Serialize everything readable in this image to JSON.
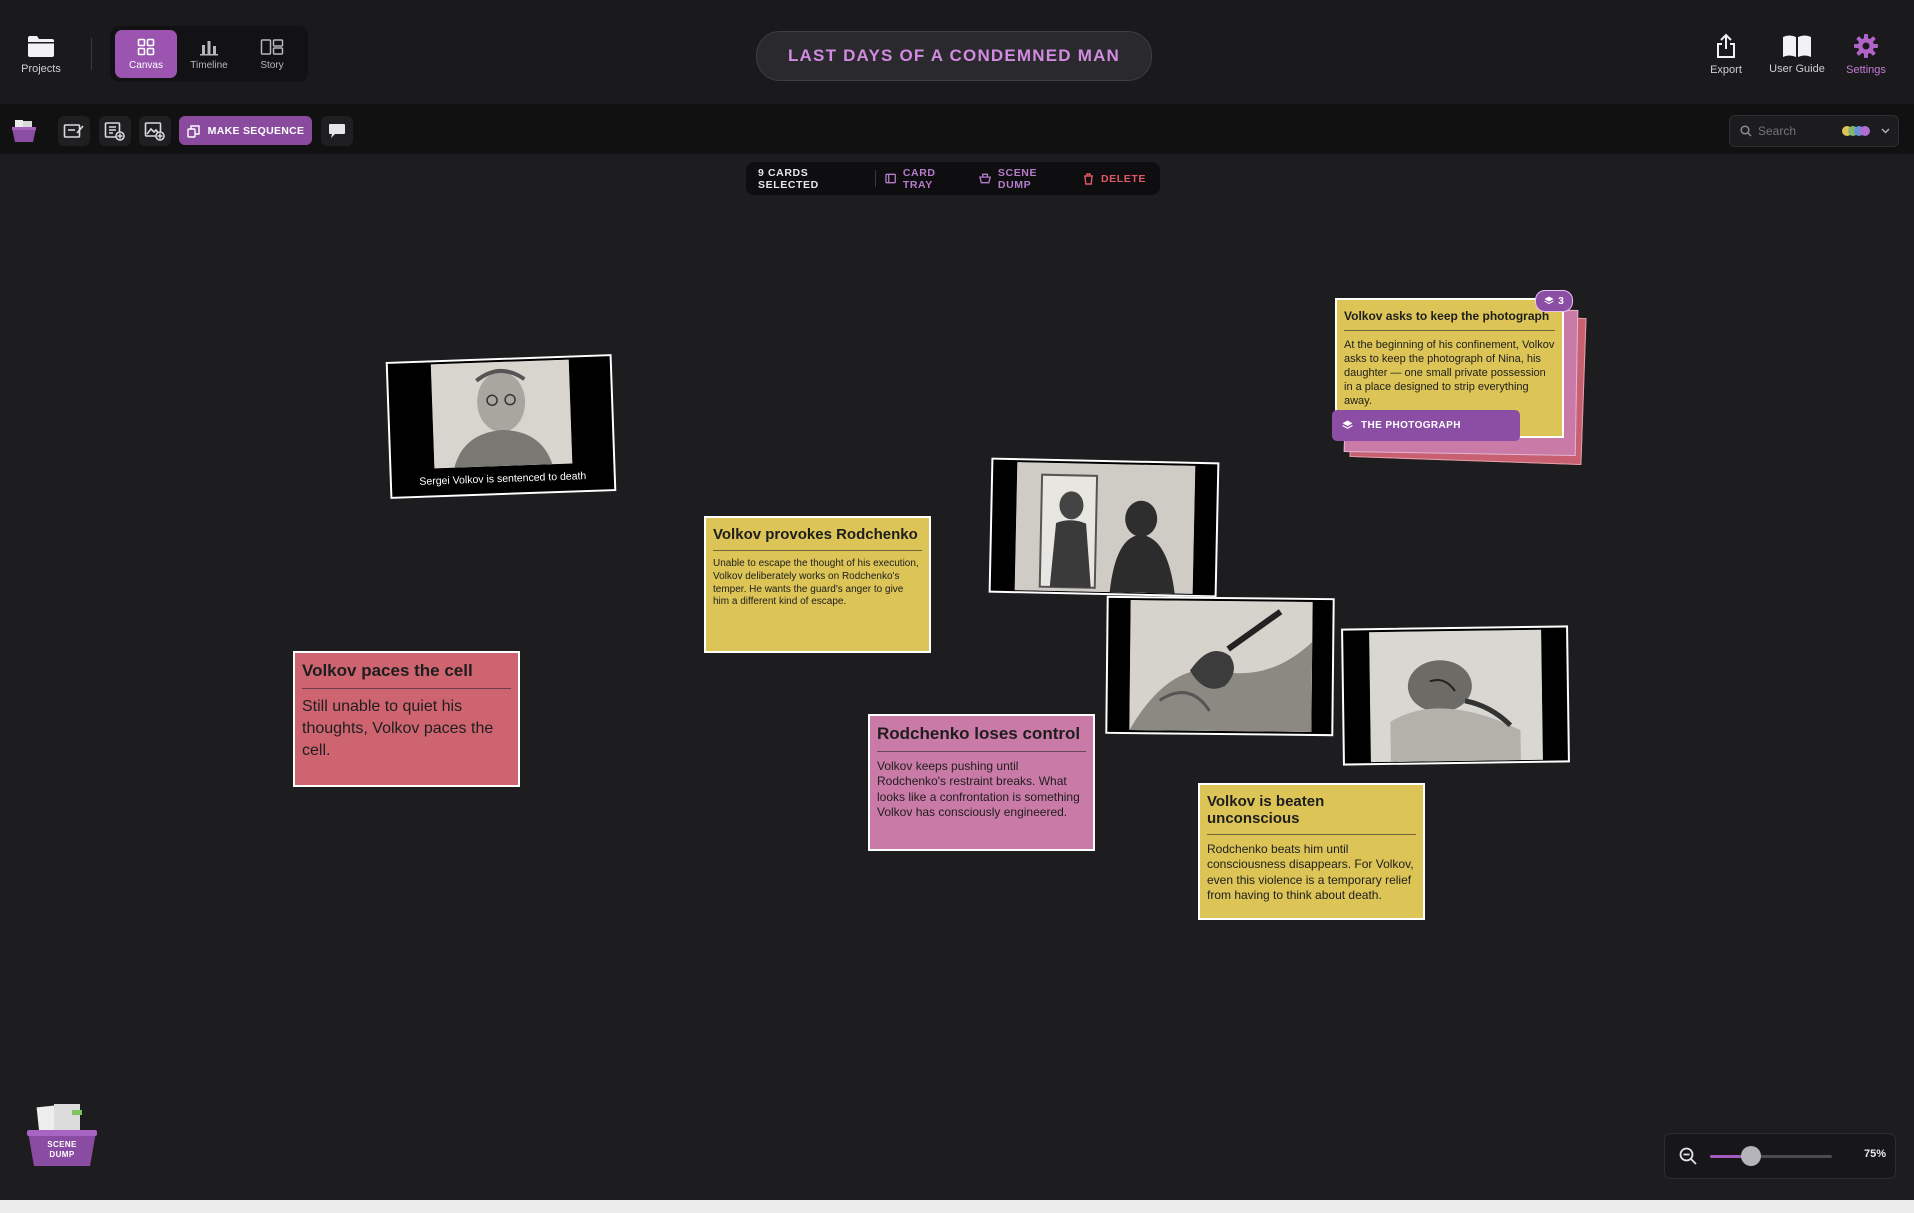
{
  "header": {
    "projects_label": "Projects",
    "modes": [
      {
        "label": "Canvas",
        "icon": "grid-icon"
      },
      {
        "label": "Timeline",
        "icon": "bar-chart-icon"
      },
      {
        "label": "Story",
        "icon": "story-icon"
      }
    ],
    "active_mode": "Canvas",
    "title": "LAST DAYS OF A CONDEMNED MAN",
    "right_actions": [
      {
        "label": "Export",
        "icon": "share-icon"
      },
      {
        "label": "User Guide",
        "icon": "book-icon"
      },
      {
        "label": "Settings",
        "icon": "gear-icon"
      }
    ]
  },
  "toolbar": {
    "make_sequence_label": "MAKE SEQUENCE",
    "search_placeholder": "Search"
  },
  "selection_bar": {
    "count_label": "9 CARDS SELECTED",
    "card_tray_label": "CARD TRAY",
    "scene_dump_label": "SCENE DUMP",
    "delete_label": "DELETE"
  },
  "cards": {
    "photo": {
      "title": "Volkov asks to keep the photograph",
      "body": "At the beginning of his confinement, Volkov asks to keep the photograph of Nina, his daughter — one small private possession in a place designed to strip everything away.",
      "sequence_label": "THE PHOTOGRAPH",
      "stack_count": "3"
    },
    "sentenced": {
      "caption": "Sergei Volkov is sentenced to death"
    },
    "provokes": {
      "title": "Volkov provokes Rodchenko",
      "body": "Unable to escape the thought of his execution, Volkov deliberately works on Rodchenko's temper. He wants the guard's anger to give him a different kind of escape."
    },
    "paces": {
      "title": "Volkov paces the cell",
      "body": "Still unable to quiet his thoughts, Volkov paces the cell."
    },
    "loses_control": {
      "title": "Rodchenko loses control",
      "body": "Volkov keeps pushing until Rodchenko's restraint breaks. What looks like a confrontation is something Volkov has consciously engineered."
    },
    "beaten": {
      "title": "Volkov is beaten unconscious",
      "body": "Rodchenko beats him until consciousness disappears. For Volkov, even this violence is a temporary relief from having to think about death."
    }
  },
  "scene_dump_widget": {
    "label_line1": "SCENE",
    "label_line2": "DUMP"
  },
  "zoom": {
    "value_label": "75%",
    "level": 0.34
  },
  "colors": {
    "accent": "#9b55b0",
    "yellow_card": "#dcc457",
    "red_card": "#cd6470",
    "pink_card": "#c97aa6",
    "delete": "#e05866"
  }
}
